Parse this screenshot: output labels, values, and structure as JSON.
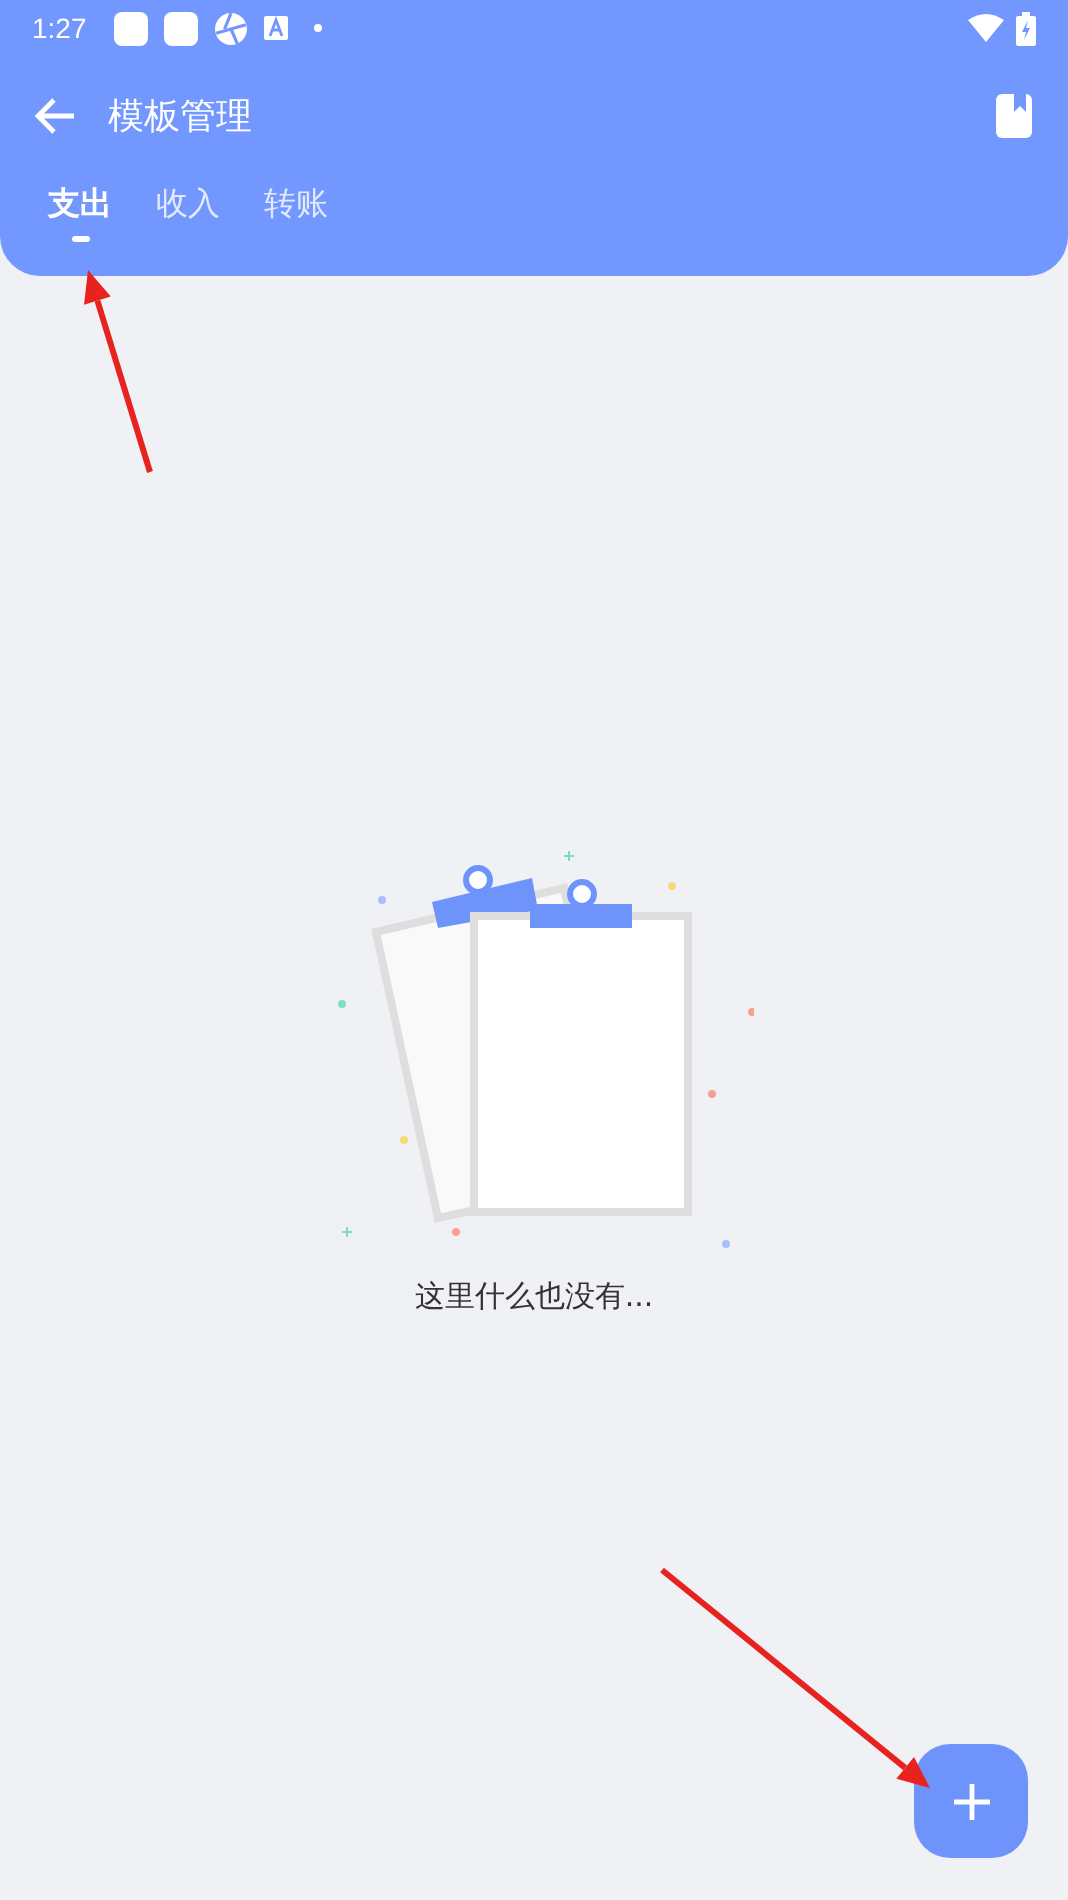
{
  "status_bar": {
    "time": "1:27"
  },
  "app_bar": {
    "title": "模板管理"
  },
  "tabs": [
    {
      "label": "支出",
      "selected": true
    },
    {
      "label": "收入",
      "selected": false
    },
    {
      "label": "转账",
      "selected": false
    }
  ],
  "empty_state": {
    "message": "这里什么也没有..."
  }
}
